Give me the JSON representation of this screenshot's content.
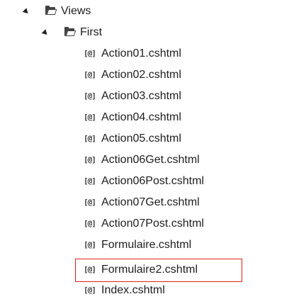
{
  "tree": {
    "folders": [
      {
        "label": "Views",
        "expanded": true,
        "icon": "folder-icon"
      },
      {
        "label": "First",
        "expanded": true,
        "icon": "folder-icon"
      }
    ],
    "file_icon_glyph": "[@]",
    "files": [
      {
        "label": "Action01.cshtml"
      },
      {
        "label": "Action02.cshtml"
      },
      {
        "label": "Action03.cshtml"
      },
      {
        "label": "Action04.cshtml"
      },
      {
        "label": "Action05.cshtml"
      },
      {
        "label": "Action06Get.cshtml"
      },
      {
        "label": "Action06Post.cshtml"
      },
      {
        "label": "Action07Get.cshtml"
      },
      {
        "label": "Action07Post.cshtml"
      },
      {
        "label": "Formulaire.cshtml"
      },
      {
        "label": "Formulaire2.cshtml",
        "highlighted": true
      },
      {
        "label": "Index.cshtml"
      }
    ]
  },
  "colors": {
    "text": "#1e1e1e",
    "highlight_border": "#e02020",
    "background": "#ffffff"
  }
}
